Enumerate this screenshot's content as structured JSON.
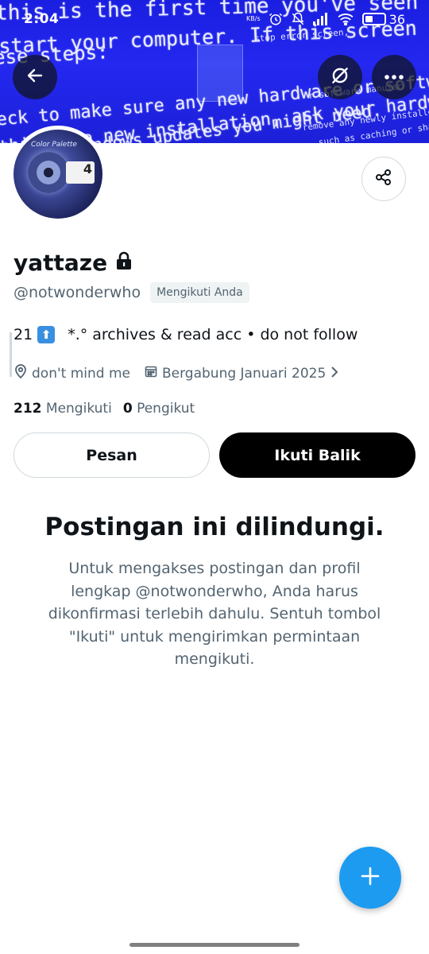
{
  "status_bar": {
    "time": "2:04",
    "network_speed": "KB/s",
    "battery_percent": "36"
  },
  "banner": {
    "lines": [
      "this is the first time you've seen this stop error screen,",
      "start your computer. If this screen appears again, follow",
      "ese steps:",
      "eck to make sure any new hardware or software is properly installed",
      "this is a new installation, ask your hardware or software manufact",
      "windows updates you might need."
    ],
    "small_lines": [
      "stop error screen,",
      "remove any newly installed hardware",
      "such as caching or shadowing",
      "r software manufac"
    ]
  },
  "avatar": {
    "caption": "Color Palette",
    "card_number": "4"
  },
  "profile": {
    "display_name": "yattaze",
    "handle": "@notwonderwho",
    "follows_you_badge": "Mengikuti Anda",
    "bio_number": "21",
    "bio_emoji_arrow": "⬆",
    "bio_text": "*.° archives & read acc  • do not follow",
    "location": "don't mind me",
    "joined": "Bergabung Januari 2025",
    "following_count": "212",
    "following_label": "Mengikuti",
    "followers_count": "0",
    "followers_label": "Pengikut"
  },
  "actions": {
    "message_label": "Pesan",
    "follow_back_label": "Ikuti Balik"
  },
  "protected": {
    "title": "Postingan ini dilindungi.",
    "body": "Untuk mengakses postingan dan profil lengkap @notwonderwho, Anda harus dikonfirmasi terlebih dahulu. Sentuh tombol \"Ikuti\" untuk mengirimkan permintaan mengikuti."
  },
  "colors": {
    "accent": "#1d9bf0",
    "banner_blue": "#2428f0",
    "text_primary": "#0f1419",
    "text_secondary": "#536471"
  },
  "icons": {
    "back": "arrow-left-icon",
    "grok": "grok-icon",
    "more": "more-horizontal-icon",
    "share": "share-icon",
    "lock": "lock-icon",
    "location": "location-pin-icon",
    "calendar": "calendar-icon",
    "fab": "plus-icon"
  }
}
